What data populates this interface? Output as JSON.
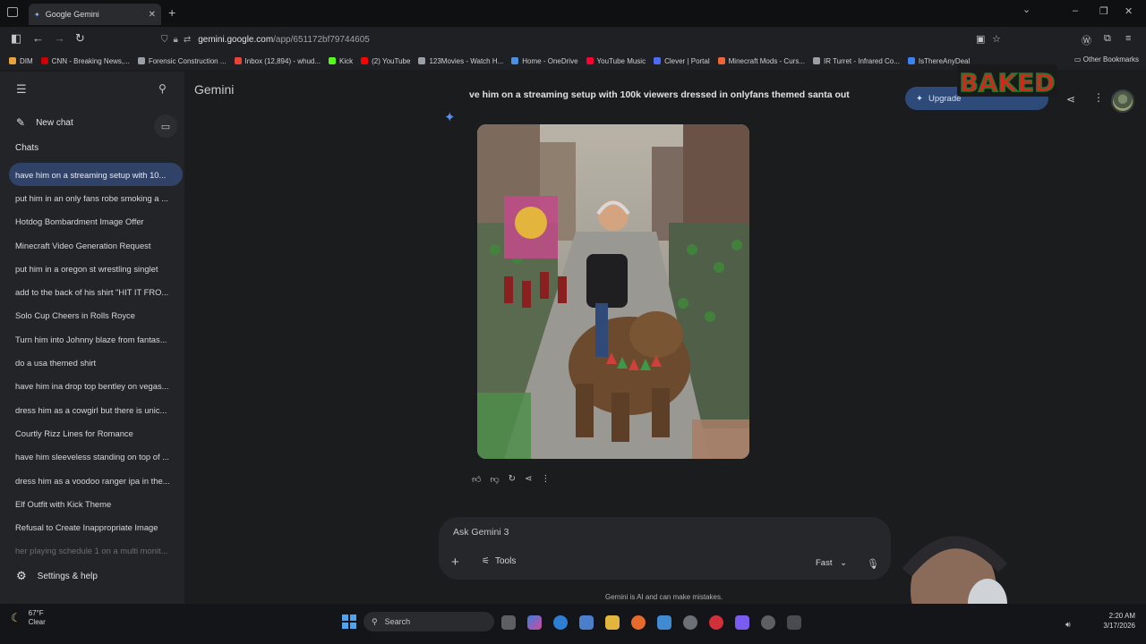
{
  "browser": {
    "tab_title": "Google Gemini",
    "url_host": "gemini.google.com",
    "url_path": "/app/651172bf79744605",
    "bookmarks": [
      {
        "label": "DIM",
        "color": "#e8a33d"
      },
      {
        "label": "CNN - Breaking News,...",
        "color": "#cc0000"
      },
      {
        "label": "Forensic Construction ...",
        "color": "#9aa0a6"
      },
      {
        "label": "Inbox (12,894) - whud...",
        "color": "#ea4335"
      },
      {
        "label": "Kick",
        "color": "#53fc18"
      },
      {
        "label": "(2) YouTube",
        "color": "#ff0000"
      },
      {
        "label": "123Movies - Watch H...",
        "color": "#9aa0a6"
      },
      {
        "label": "Home - OneDrive",
        "color": "#4a90e2"
      },
      {
        "label": "YouTube Music",
        "color": "#ff0033"
      },
      {
        "label": "Clever | Portal",
        "color": "#4a6cf7"
      },
      {
        "label": "Minecraft Mods - Curs...",
        "color": "#f16436"
      },
      {
        "label": "IR Turret - Infrared Co...",
        "color": "#9aa0a6"
      },
      {
        "label": "IsThereAnyDeal",
        "color": "#3b82f6"
      }
    ],
    "other_bookmarks": "Other Bookmarks"
  },
  "sidebar": {
    "new_chat": "New chat",
    "chats_title": "Chats",
    "chats": [
      "have him on a streaming setup with 10...",
      "put him in an only fans robe smoking a ...",
      "Hotdog Bombardment Image Offer",
      "Minecraft Video Generation Request",
      "put him in a oregon st wrestling singlet",
      "add to the back of his shirt \"HIT IT FRO...",
      "Solo Cup Cheers in Rolls Royce",
      "Turn him into Johnny blaze from fantas...",
      "do a usa themed shirt",
      "have him ina drop top bentley on vegas...",
      "dress him as a cowgirl but there is unic...",
      "Courtly Rizz Lines for Romance",
      "have him sleeveless standing on top of ...",
      "dress him as a voodoo ranger ipa in the...",
      "Elf Outfit with Kick Theme",
      "Refusal to Create Inappropriate Image",
      "her playing schedule 1 on a multi monit..."
    ],
    "settings": "Settings & help"
  },
  "main": {
    "brand": "Gemini",
    "prompt": "ve him on a streaming setup with 100k viewers dressed in onlyfans themed santa out",
    "upgrade_label": "Upgrade",
    "overlay_logo_text": "BAKED",
    "input_placeholder": "Ask Gemini 3",
    "tools_label": "Tools",
    "mode_label": "Fast",
    "disclaimer": "Gemini is AI and can make mistakes."
  },
  "taskbar": {
    "temperature": "67°F",
    "weather": "Clear",
    "search_label": "Search",
    "time": "2:20 AM",
    "date": "3/17/2026"
  },
  "colors": {
    "accent": "#304268",
    "upgrade_bg": "#2d4a78",
    "sidebar_bg": "#232427",
    "main_bg": "#1b1c1e"
  }
}
